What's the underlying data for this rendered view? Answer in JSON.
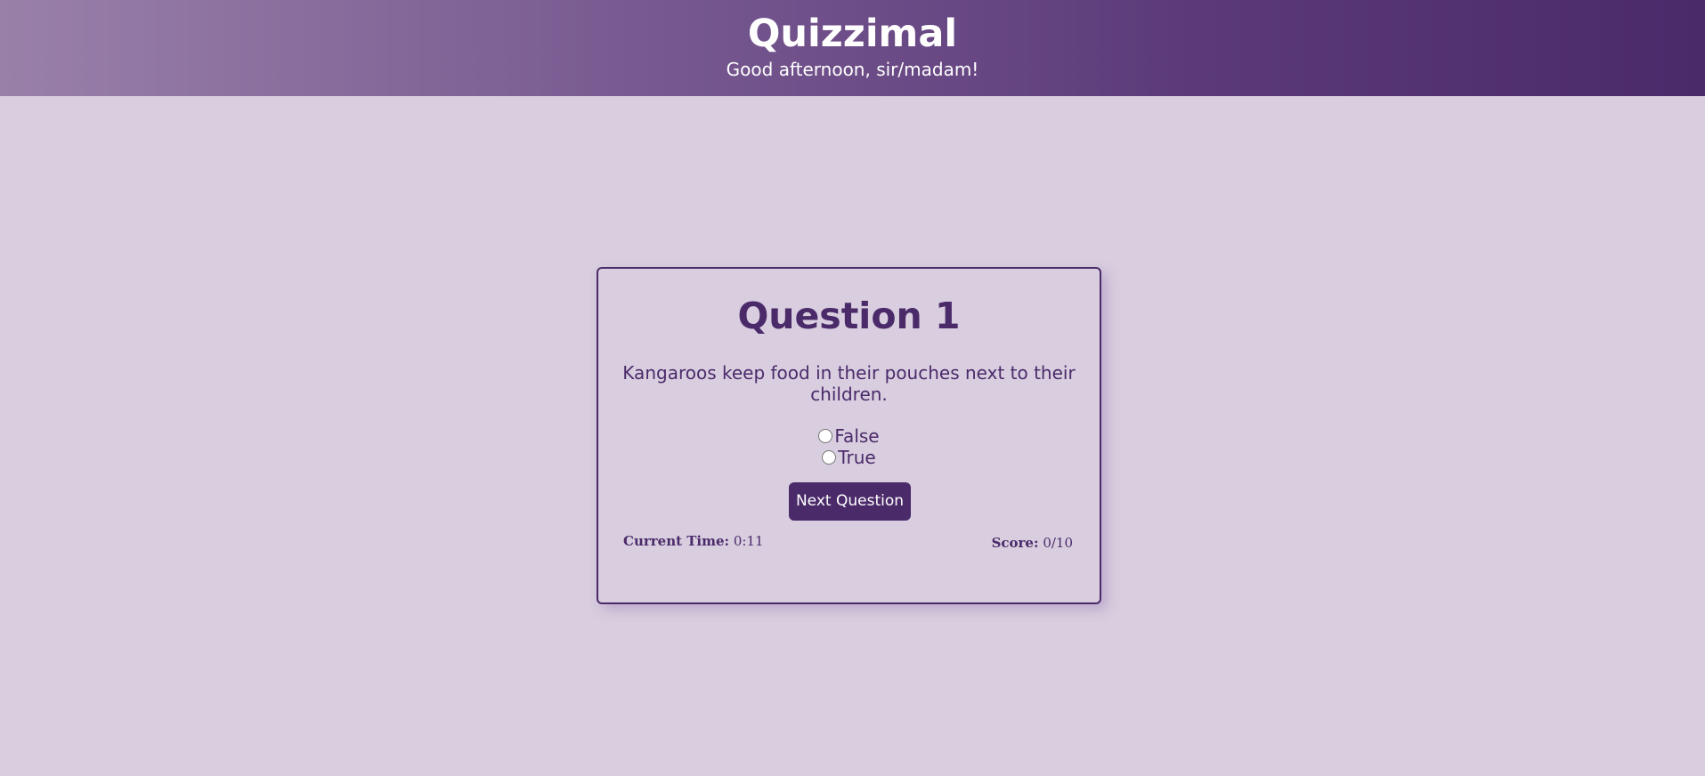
{
  "header": {
    "title": "Quizzimal",
    "greeting": "Good afternoon, sir/madam!"
  },
  "quiz": {
    "question_title": "Question 1",
    "question_text": "Kangaroos keep food in their pouches next to their children.",
    "options": [
      "False",
      "True"
    ],
    "selected": null,
    "next_button_label": "Next Question"
  },
  "status": {
    "time_label": "Current Time:",
    "time_value": "0:11",
    "score_label": "Score:",
    "score_value": "0/10"
  },
  "colors": {
    "accent": "#4b2a6a",
    "background": "#d8cedf",
    "header_gradient_start": "#9980a9",
    "header_gradient_end": "#4b2a6a"
  }
}
